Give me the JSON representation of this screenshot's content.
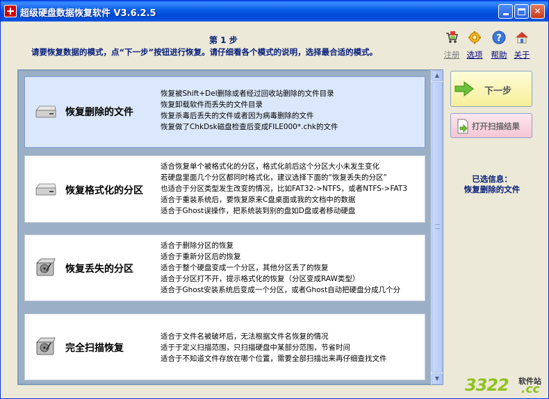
{
  "window": {
    "title": "超级硬盘数据恢复软件 V3.6.2.5",
    "minimize": "",
    "maximize": "",
    "close": "✕"
  },
  "header": {
    "step_title": "第 1 步",
    "step_desc": "请要恢复数据的模式，点“下一步”按钮进行恢复。请仔细看各个模式的说明，选择最合适的模式。",
    "buttons": [
      {
        "label": "注册",
        "icon": "cart-icon",
        "enabled": false
      },
      {
        "label": "选项",
        "icon": "gear-icon",
        "enabled": true
      },
      {
        "label": "帮助",
        "icon": "help-icon",
        "enabled": true
      },
      {
        "label": "关于",
        "icon": "house-icon",
        "enabled": true
      }
    ]
  },
  "options": [
    {
      "title": "恢复删除的文件",
      "icon": "disk-drive-icon",
      "selected": true,
      "lines": [
        "恢复被Shift+Del删除或者经过回收站删除的文件目录",
        "恢复卸载软件而丢失的文件目录",
        "恢复杀毒后丢失的文件或者因为病毒删除的文件",
        "恢复做了ChkDsk磁盘检查后变成FILE000*.chk的文件"
      ]
    },
    {
      "title": "恢复格式化的分区",
      "icon": "disk-drive-icon",
      "selected": false,
      "lines": [
        "适合恢复单个被格式化的分区，格式化前后这个分区大小未发生变化",
        "若硬盘里面几个分区都同时格式化，建议选择下面的“恢复丢失的分区”",
        "也适合于分区类型发生改变的情况，比如FAT32->NTFS，或者NTFS->FAT3",
        "适合于重装系统后，要恢复原来C盘桌面或我的文档中的数据",
        "适合于Ghost误操作，把系统装到别的盘如D盘或者移动硬盘"
      ]
    },
    {
      "title": "恢复丢失的分区",
      "icon": "hard-disk-icon",
      "selected": false,
      "lines": [
        "适合于删除分区的恢复",
        "适合于重新分区后的恢复",
        "适合于整个硬盘变成一个分区，其他分区丢了的恢复",
        "适合于分区打不开，提示格式化的恢复（分区变成RAW类型）",
        "适合于Ghost安装系统后变成一个分区，或者Ghost自动把硬盘分成几个分"
      ]
    },
    {
      "title": "完全扫描恢复",
      "icon": "hard-disk-icon",
      "selected": false,
      "lines": [
        "适合于文件名被破坏后，无法根据文件名恢复的情况",
        "适于于定义扫描范围，只扫描硬盘中某部分范围，节省时间",
        "适合于不知道文件存放在哪个位置，需要全部扫描出来再仔细查找文件"
      ]
    }
  ],
  "actions": {
    "next_label": "下一步",
    "open_scan_label": "打开扫描结果"
  },
  "selected_info": {
    "label": "已选信息：",
    "value": "恢复删除的文件"
  },
  "watermark": {
    "number": "3322",
    "cn": "软件站",
    "tld": ".cc"
  },
  "colors": {
    "title_bar": "#0054e3",
    "heading_text": "#08207a",
    "selected_row": "#dbe8fb",
    "next_button": "#f6ef9a",
    "open_button": "#f5c6d5"
  }
}
